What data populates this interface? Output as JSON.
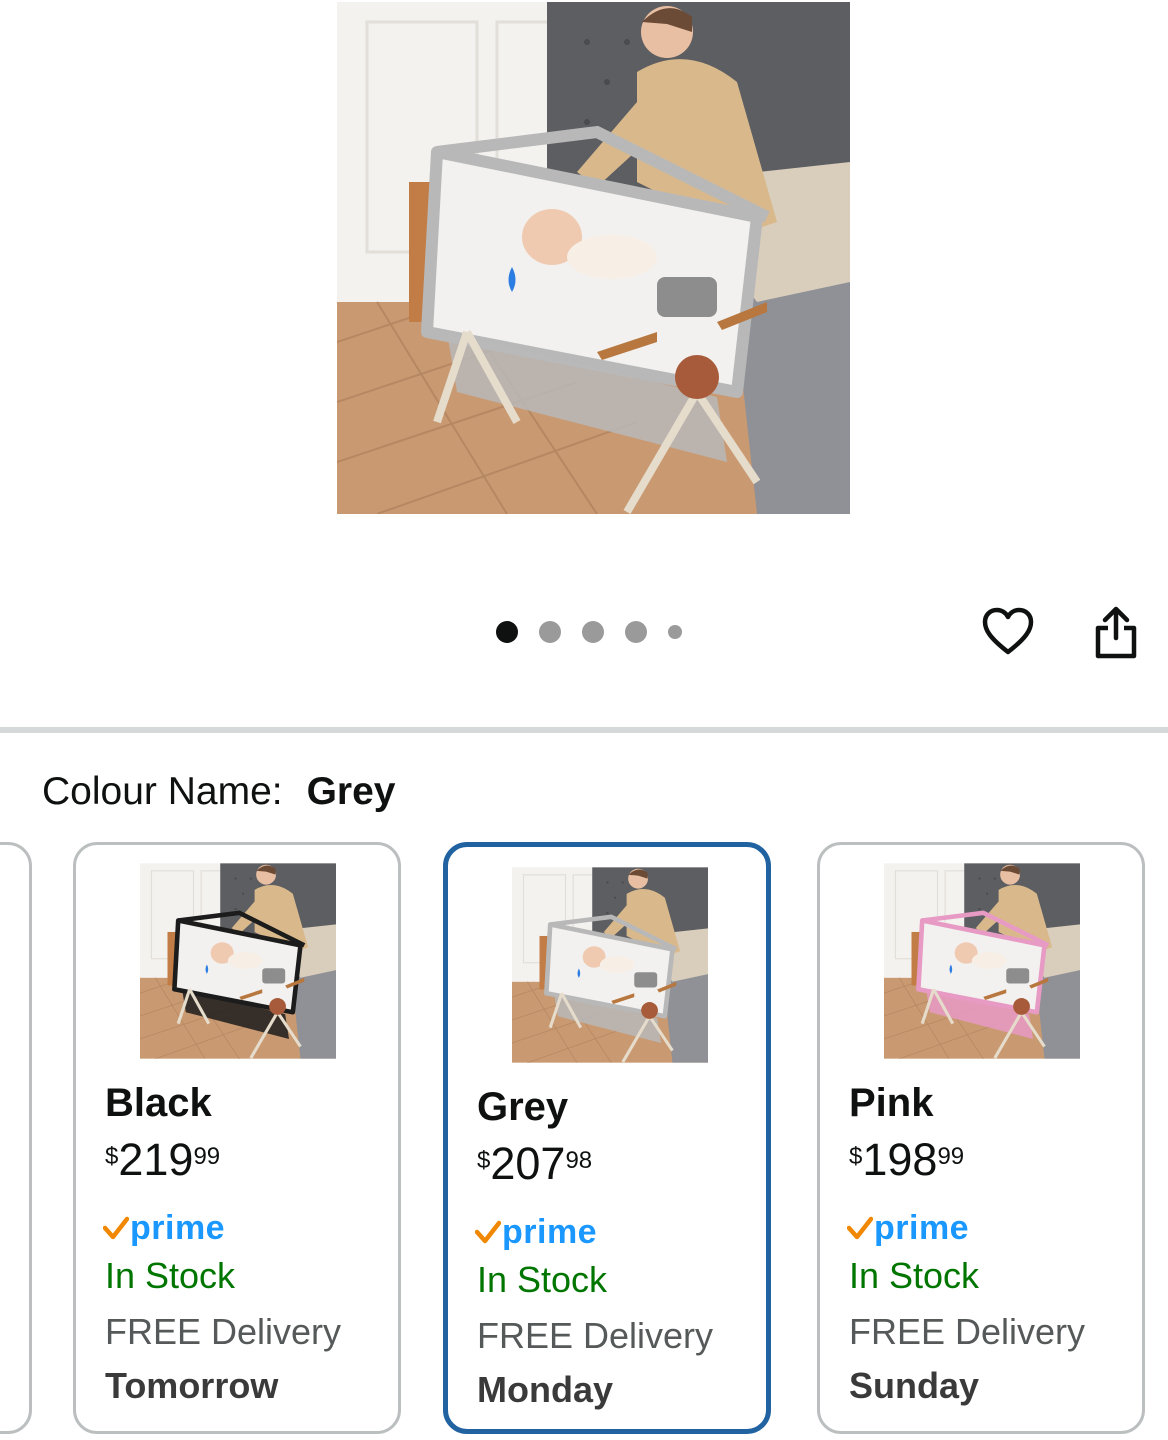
{
  "gallery": {
    "image_alt": "Baby bedside crib with woman placing smiling baby inside",
    "dot_count": 5,
    "active_dot": 0
  },
  "actions": {
    "wishlist_icon": "heart-icon",
    "share_icon": "share-icon"
  },
  "colour": {
    "label": "Colour Name:",
    "value": "Grey"
  },
  "variants": [
    {
      "name": "Black",
      "price_symbol": "$",
      "price_whole": "219",
      "price_fraction": "99",
      "prime": "prime",
      "stock": "In Stock",
      "delivery_label": "FREE Delivery",
      "delivery_day": "Tomorrow",
      "frame_color": "#1c1c1c",
      "selected": false
    },
    {
      "name": "Grey",
      "price_symbol": "$",
      "price_whole": "207",
      "price_fraction": "98",
      "prime": "prime",
      "stock": "In Stock",
      "delivery_label": "FREE Delivery",
      "delivery_day": "Monday",
      "frame_color": "#b8b8b8",
      "selected": true
    },
    {
      "name": "Pink",
      "price_symbol": "$",
      "price_whole": "198",
      "price_fraction": "99",
      "prime": "prime",
      "stock": "In Stock",
      "delivery_label": "FREE Delivery",
      "delivery_day": "Sunday",
      "frame_color": "#e79ac4",
      "selected": false
    }
  ],
  "colors": {
    "selected_border": "#2162a1",
    "in_stock": "#007600",
    "prime_blue": "#1a98ff",
    "prime_check": "#f08804"
  }
}
